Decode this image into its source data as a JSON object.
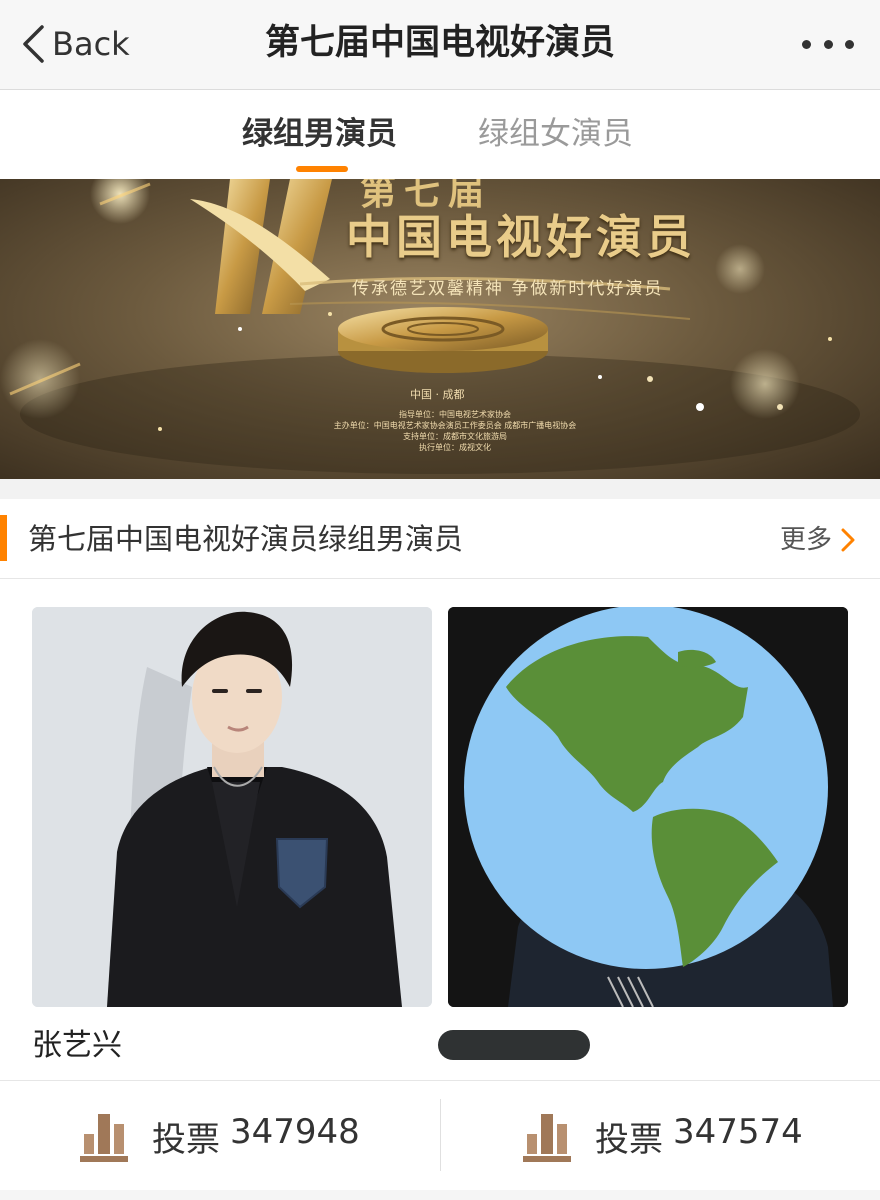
{
  "nav": {
    "back_label": "Back",
    "title": "第七届中国电视好演员"
  },
  "tabs": [
    {
      "label": "绿组男演员",
      "active": true
    },
    {
      "label": "绿组女演员",
      "active": false
    }
  ],
  "banner": {
    "title_top": "第七届",
    "title": "中国电视好演员",
    "subtitle": "传承德艺双馨精神 争做新时代好演员",
    "city": "中国 · 成都",
    "info": [
      "指导单位：中国电视艺术家协会",
      "主办单位：中国电视艺术家协会演员工作委员会 成都市广播电视协会",
      "支持单位：成都市文化旅游局",
      "执行单位：成视文化"
    ]
  },
  "section": {
    "title": "第七届中国电视好演员绿组男演员",
    "more_label": "更多"
  },
  "candidates": [
    {
      "name": "张艺兴",
      "vote_label": "投票",
      "votes": "347948"
    },
    {
      "name": "",
      "vote_label": "投票",
      "votes": "347574"
    }
  ],
  "colors": {
    "accent": "#ff8200",
    "vote_icon": "#a07858"
  },
  "icons": {
    "back": "chevron-left-icon",
    "more": "ellipsis-icon",
    "section_more": "chevron-right-icon",
    "vote": "bar-chart-icon",
    "overlay": "globe-icon"
  }
}
